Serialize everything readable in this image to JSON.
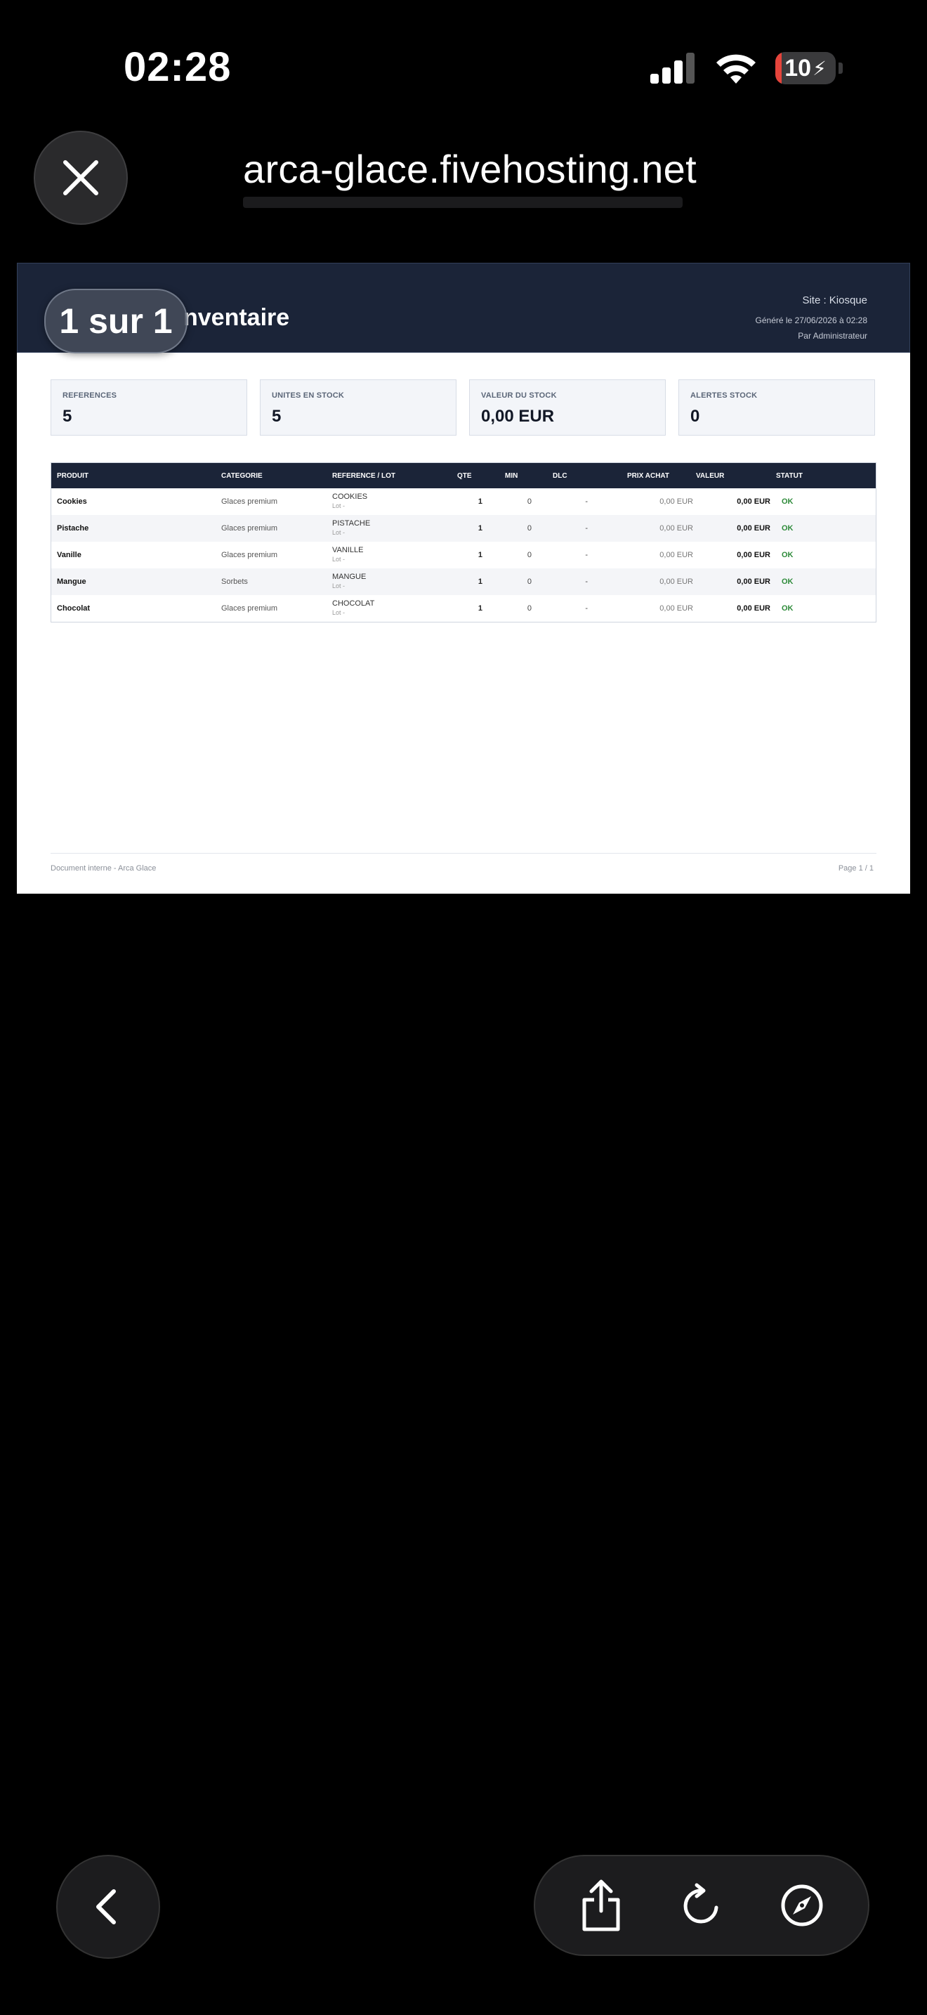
{
  "status_bar": {
    "time": "02:28",
    "battery": "10",
    "battery_level": 0.1
  },
  "nav": {
    "url": "arca-glace.fivehosting.net"
  },
  "viewer": {
    "page_indicator": "1 sur 1"
  },
  "document": {
    "title": "nventaire",
    "site": "Site : Kiosque",
    "generated": "Généré le 27/06/2026 à 02:28",
    "author": "Par Administrateur",
    "cards": [
      {
        "label": "REFERENCES",
        "value": "5"
      },
      {
        "label": "UNITES EN STOCK",
        "value": "5"
      },
      {
        "label": "VALEUR DU STOCK",
        "value": "0,00 EUR"
      },
      {
        "label": "ALERTES STOCK",
        "value": "0"
      }
    ],
    "table": {
      "headers": [
        "PRODUIT",
        "CATEGORIE",
        "REFERENCE / LOT",
        "QTE",
        "MIN",
        "DLC",
        "PRIX ACHAT",
        "VALEUR",
        "STATUT"
      ],
      "rows": [
        {
          "produit": "Cookies",
          "categorie": "Glaces premium",
          "reference": "COOKIES",
          "lot": "Lot -",
          "qte": "1",
          "min": "0",
          "dlc": "-",
          "prix_achat": "0,00 EUR",
          "valeur": "0,00 EUR",
          "statut": "OK"
        },
        {
          "produit": "Pistache",
          "categorie": "Glaces premium",
          "reference": "PISTACHE",
          "lot": "Lot -",
          "qte": "1",
          "min": "0",
          "dlc": "-",
          "prix_achat": "0,00 EUR",
          "valeur": "0,00 EUR",
          "statut": "OK"
        },
        {
          "produit": "Vanille",
          "categorie": "Glaces premium",
          "reference": "VANILLE",
          "lot": "Lot -",
          "qte": "1",
          "min": "0",
          "dlc": "-",
          "prix_achat": "0,00 EUR",
          "valeur": "0,00 EUR",
          "statut": "OK"
        },
        {
          "produit": "Mangue",
          "categorie": "Sorbets",
          "reference": "MANGUE",
          "lot": "Lot -",
          "qte": "1",
          "min": "0",
          "dlc": "-",
          "prix_achat": "0,00 EUR",
          "valeur": "0,00 EUR",
          "statut": "OK"
        },
        {
          "produit": "Chocolat",
          "categorie": "Glaces premium",
          "reference": "CHOCOLAT",
          "lot": "Lot -",
          "qte": "1",
          "min": "0",
          "dlc": "-",
          "prix_achat": "0,00 EUR",
          "valeur": "0,00 EUR",
          "statut": "OK"
        }
      ]
    },
    "footer_left": "Document interne - Arca Glace",
    "footer_right": "Page 1 / 1"
  },
  "toolbar": {
    "icons": [
      "close-icon",
      "back-chevron-icon",
      "share-icon",
      "reload-icon",
      "safari-compass-icon"
    ]
  },
  "colors": {
    "header_navy": "#1b2438",
    "status_ok": "#2e8b3a",
    "battery_red": "#e5443b"
  }
}
